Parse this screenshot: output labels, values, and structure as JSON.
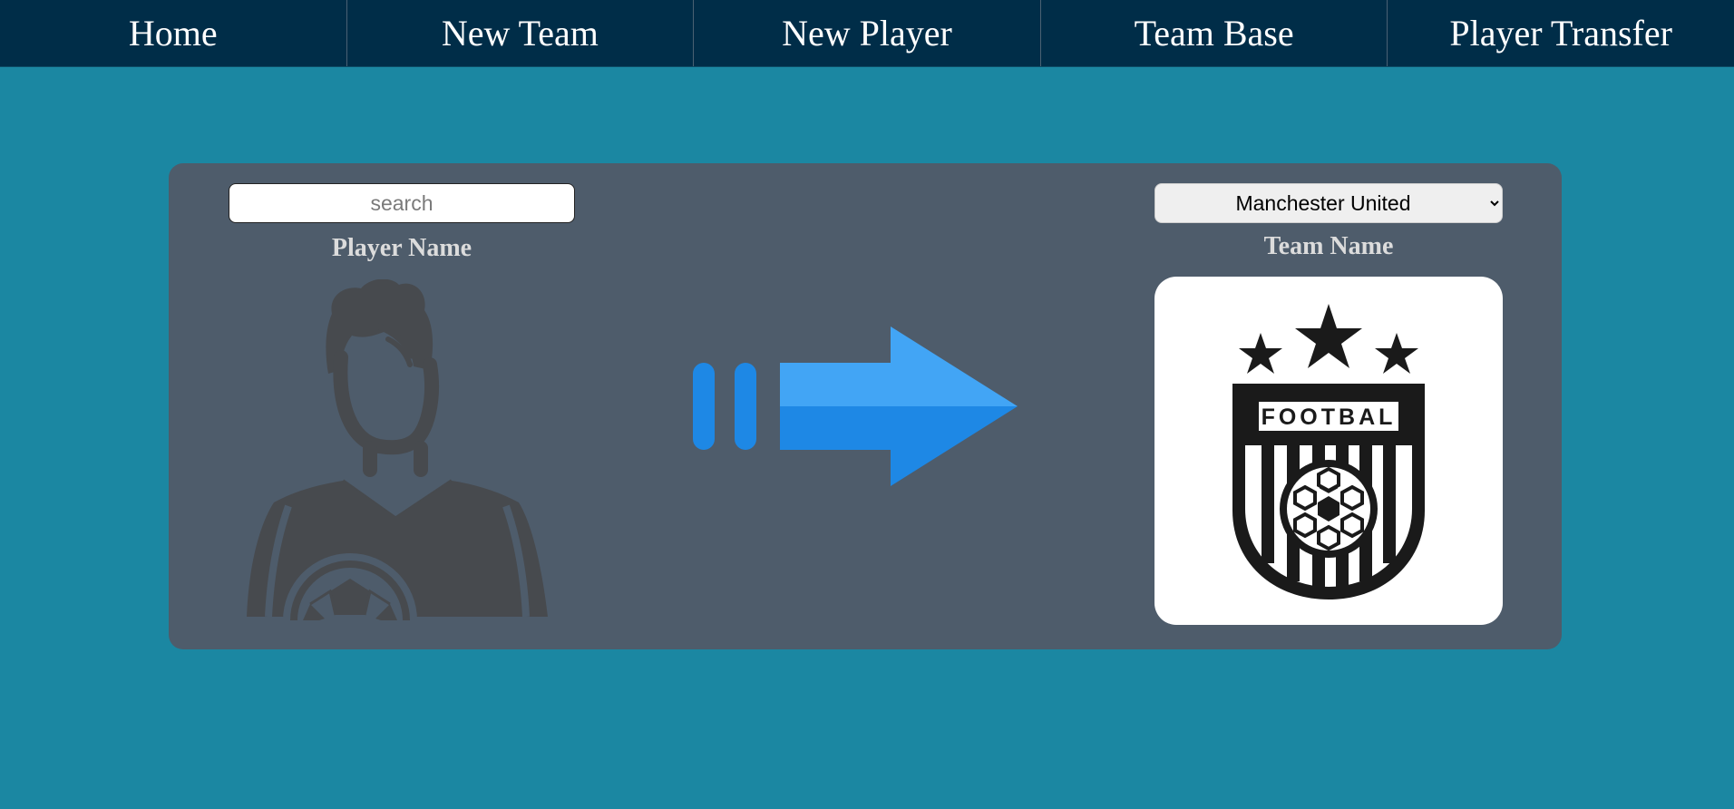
{
  "nav": {
    "items": [
      {
        "label": "Home"
      },
      {
        "label": "New Team"
      },
      {
        "label": "New Player"
      },
      {
        "label": "Team Base"
      },
      {
        "label": "Player Transfer"
      }
    ]
  },
  "player": {
    "search_placeholder": "search",
    "name_label": "Player Name",
    "avatar_icon": "footballer-silhouette-icon"
  },
  "transfer": {
    "arrow_icon": "transfer-arrow-icon"
  },
  "team": {
    "selected": "Manchester United",
    "name_label": "Team Name",
    "logo_icon": "football-crest-icon",
    "logo_text": "FOOTBAL"
  },
  "colors": {
    "background": "#1b87a2",
    "navbar": "#002d48",
    "panel": "#4e5c6b",
    "arrow_light": "#42a5f5",
    "arrow_dark": "#1e88e5"
  }
}
